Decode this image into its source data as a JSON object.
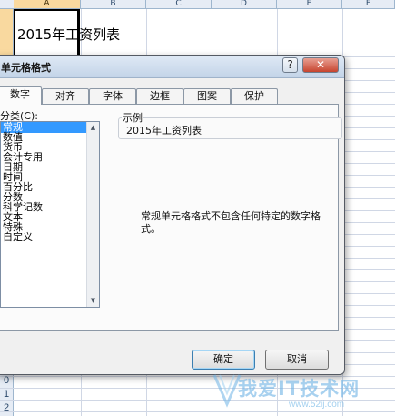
{
  "spreadsheet": {
    "columns": [
      "A",
      "B",
      "C",
      "D",
      "E",
      "F"
    ],
    "selected_column": "A",
    "active_cell_text": "2015年工资列表",
    "row_numbers": [
      "0",
      "1",
      "2"
    ]
  },
  "dialog": {
    "title": "单元格格式",
    "help_label": "?",
    "close_label": "✕",
    "tabs": [
      "数字",
      "对齐",
      "字体",
      "边框",
      "图案",
      "保护"
    ],
    "active_tab": "数字",
    "category_label": "分类(C):",
    "categories": [
      "常规",
      "数值",
      "货币",
      "会计专用",
      "日期",
      "时间",
      "百分比",
      "分数",
      "科学记数",
      "文本",
      "特殊",
      "自定义"
    ],
    "selected_category": "常规",
    "sample_label": "示例",
    "sample_value": "2015年工资列表",
    "description": "常规单元格格式不包含任何特定的数字格式。",
    "ok_label": "确定",
    "cancel_label": "取消"
  },
  "watermark": {
    "text": "我爱IT技术网",
    "url": "www.52ij.com"
  },
  "colors": {
    "selection": "#3399ff",
    "header_selected": "#f9d99f",
    "close_button": "#c7442f"
  }
}
